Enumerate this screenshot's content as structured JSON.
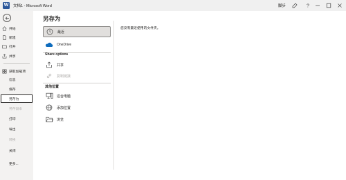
{
  "window": {
    "title": "文档1 - Microsoft Word",
    "logo_letter": "W",
    "user": "脚步"
  },
  "sidebar": {
    "items": [
      {
        "label": "开始",
        "icon": "home-icon"
      },
      {
        "label": "新建",
        "icon": "new-document-icon"
      },
      {
        "label": "打开",
        "icon": "open-folder-icon"
      },
      {
        "label": "共享",
        "icon": "share-icon"
      },
      {
        "label": "获取加载项",
        "icon": "add-ins-icon"
      },
      {
        "label": "信息"
      },
      {
        "label": "保存"
      },
      {
        "label": "另存为",
        "selected": true
      },
      {
        "label": "另存副本",
        "disabled": true
      },
      {
        "label": "打印"
      },
      {
        "label": "导出"
      },
      {
        "label": "转换",
        "disabled": true
      },
      {
        "label": "关闭"
      },
      {
        "label": "更多..."
      }
    ]
  },
  "main": {
    "title": "另存为",
    "locations": [
      {
        "label": "最近",
        "icon": "clock-icon",
        "selected": true
      },
      {
        "label": "OneDrive",
        "icon": "onedrive-cloud-icon"
      }
    ],
    "share_options_heading": "Share options",
    "share_options": [
      {
        "label": "共享",
        "icon": "share-icon"
      },
      {
        "label": "复制链接",
        "icon": "link-icon",
        "disabled": true
      }
    ],
    "other_locations_heading": "其他位置",
    "other_locations": [
      {
        "label": "这台电脑",
        "icon": "this-pc-icon"
      },
      {
        "label": "添加位置",
        "icon": "add-location-globe-icon"
      },
      {
        "label": "浏览",
        "icon": "browse-folder-icon"
      }
    ],
    "empty_message": "您没有最近使用的文件夹。"
  },
  "colors": {
    "word_blue": "#2b579a",
    "sidebar_bg": "#f3f2f1",
    "selected_bg": "#e1dfdd",
    "text": "#252423",
    "disabled_text": "#b0aeac"
  }
}
